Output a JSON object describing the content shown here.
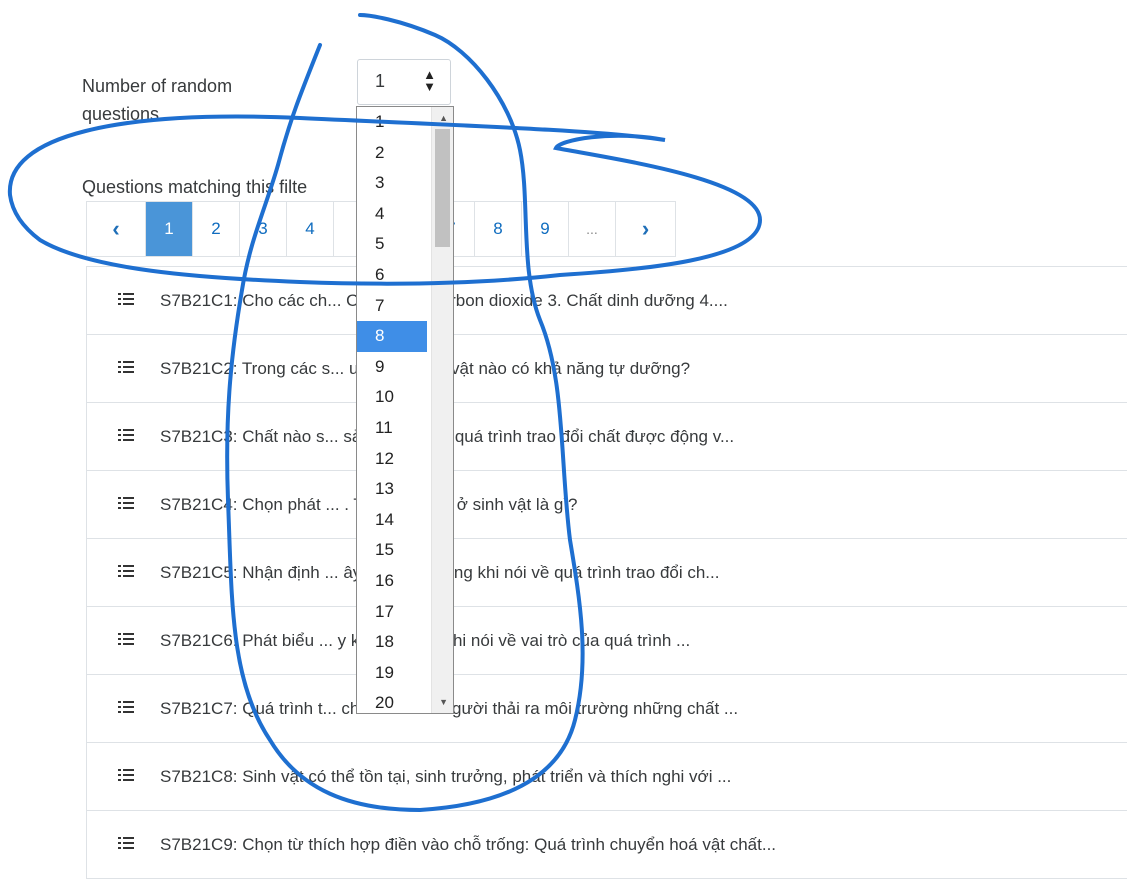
{
  "form": {
    "random_label": "Number of random questions",
    "random_value": "1",
    "select_arrows": "⬍",
    "matching_label": "Questions matching this filte"
  },
  "pagination": {
    "prev": "‹",
    "next": "›",
    "pages": [
      "1",
      "2",
      "3",
      "4",
      "",
      "",
      "7",
      "8",
      "9",
      "..."
    ],
    "active_index": 0
  },
  "dropdown": {
    "options": [
      "1",
      "2",
      "3",
      "4",
      "5",
      "6",
      "7",
      "8",
      "9",
      "10",
      "11",
      "12",
      "13",
      "14",
      "15",
      "16",
      "17",
      "18",
      "19",
      "20"
    ],
    "selected": "8"
  },
  "questions": [
    "S7B21C1: Cho các ch... Oxygen 2. Carbon dioxide 3. Chất dinh dưỡng 4....",
    "S7B21C2: Trong các s... u, nhóm sinh vật nào có khả năng tự dưỡng?",
    "S7B21C3: Chất nào s... sản phẩm của quá trình trao đổi chất được động v...",
    "S7B21C4: Chọn phát ... . Trao đổi chất ở sinh vật là gì?",
    "S7B21C5: Nhận định ... ây là không đúng khi nói về quá trình trao đổi ch...",
    "S7B21C6: Phát biểu ... y không đúng khi nói về vai trò của quá trình ...",
    "S7B21C7: Quá trình t... chất của con người thải ra môi trường những chất ...",
    "S7B21C8: Sinh vật có thể tồn tại, sinh trưởng, phát triển và thích nghi với ...",
    "S7B21C9: Chọn từ thích hợp điền vào chỗ trống: Quá trình chuyển hoá vật chất..."
  ],
  "colors": {
    "accent": "#4a95d8",
    "link": "#0f6cbf",
    "scribble": "#1e6fd0"
  },
  "icons": {
    "question": "list-icon",
    "prev": "chevron-left-icon",
    "next": "chevron-right-icon"
  }
}
